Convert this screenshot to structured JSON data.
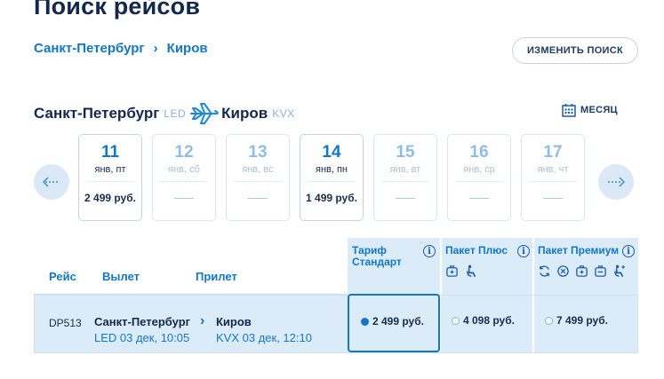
{
  "page_title": "Поиск рейсов",
  "breadcrumb": {
    "from": "Санкт-Петербург",
    "sep": "›",
    "to": "Киров"
  },
  "change_search": "ИЗМЕНИТЬ ПОИСК",
  "route": {
    "from": "Санкт-Петербург",
    "from_code": "LED",
    "to": "Киров",
    "to_code": "KVX"
  },
  "month_label": "МЕСЯЦ",
  "dates": [
    {
      "day": "11",
      "weekday": "янв, пт",
      "price": "2 499 руб.",
      "state": "active"
    },
    {
      "day": "12",
      "weekday": "янв, сб",
      "price": "",
      "state": "dim"
    },
    {
      "day": "13",
      "weekday": "янв, вс",
      "price": "",
      "state": "dim"
    },
    {
      "day": "14",
      "weekday": "янв, пн",
      "price": "1 499 руб.",
      "state": "active"
    },
    {
      "day": "15",
      "weekday": "янв, вт",
      "price": "",
      "state": "dim"
    },
    {
      "day": "16",
      "weekday": "янв, ср",
      "price": "",
      "state": "dim"
    },
    {
      "day": "17",
      "weekday": "янв, чт",
      "price": "",
      "state": "dim"
    }
  ],
  "columns": {
    "flight": "Рейс",
    "departure": "Вылет",
    "arrival": "Прилет"
  },
  "tariffs": {
    "standard": {
      "line1": "Тариф",
      "line2": "Стандарт"
    },
    "plus": "Пакет Плюс",
    "premium": "Пакет Премиум"
  },
  "flight": {
    "number": "DP513",
    "dep_city": "Санкт-Петербург",
    "dep_detail": "LED 03 дек, 10:05",
    "arrow": "›",
    "arr_city": "Киров",
    "arr_detail": "KVX 03 дек, 12:10",
    "fare_standard": "2 499 руб.",
    "fare_plus": "4 098 руб.",
    "fare_premium": "7 499 руб."
  },
  "colors": {
    "accent": "#1177c6",
    "navy": "#12284c",
    "light_bg": "#dcebf8"
  }
}
